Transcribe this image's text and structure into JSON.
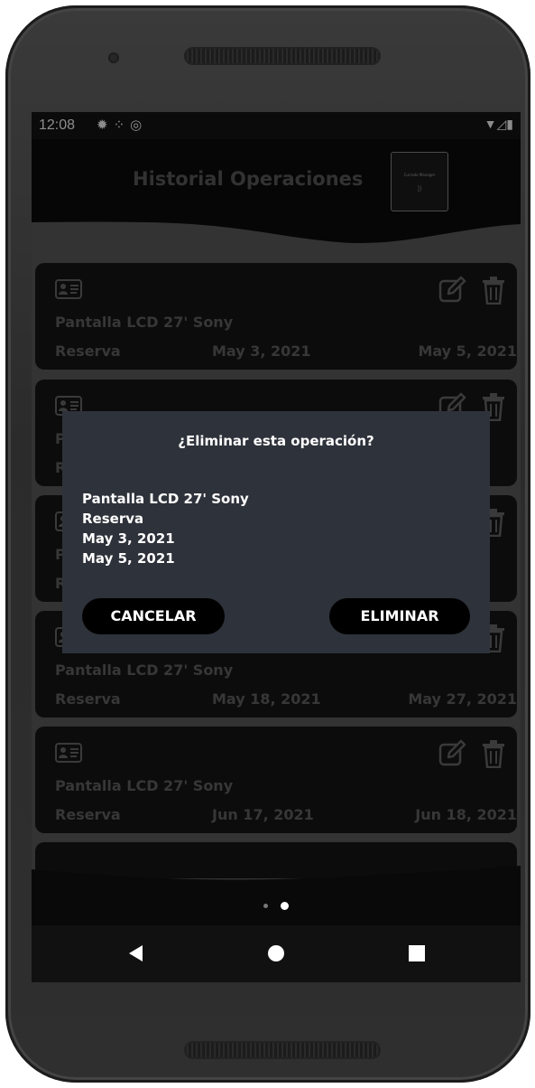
{
  "status_bar": {
    "time": "12:08",
    "left_icons": [
      "gear-icon",
      "signal-dots-icon",
      "at-icon"
    ],
    "right_icons": [
      "wifi-icon",
      "cell-signal-icon",
      "battery-icon"
    ]
  },
  "header": {
    "title": "Historial Operaciones",
    "logo_text": "Currado Manager",
    "logo_mark": "])"
  },
  "operations": [
    {
      "item": "Pantalla LCD 27' Sony",
      "type": "Reserva",
      "start": "May 3, 2021",
      "end": "May 5, 2021"
    },
    {
      "item": "Pantalla LCD 27' Sony",
      "type": "Reserva",
      "start": "",
      "end": ""
    },
    {
      "item": "Pantalla LCD 27' Sony",
      "type": "Reserva",
      "start": "",
      "end": ""
    },
    {
      "item": "Pantalla LCD 27' Sony",
      "type": "Reserva",
      "start": "May 18, 2021",
      "end": "May 27, 2021"
    },
    {
      "item": "Pantalla LCD 27' Sony",
      "type": "Reserva",
      "start": "Jun 17, 2021",
      "end": "Jun 18, 2021"
    }
  ],
  "dialog": {
    "title": "¿Eliminar esta operación?",
    "item": "Pantalla LCD 27' Sony",
    "type": "Reserva",
    "start": "May 3, 2021",
    "end": "May 5, 2021",
    "cancel_label": "CANCELAR",
    "delete_label": "ELIMINAR"
  },
  "pager": {
    "count": 2,
    "active": 1
  },
  "colors": {
    "header_bg": "#0b0b0b",
    "card_bg": "#171717",
    "card_text": "#646464",
    "dialog_bg": "#2e323a",
    "button_bg": "#000000"
  }
}
